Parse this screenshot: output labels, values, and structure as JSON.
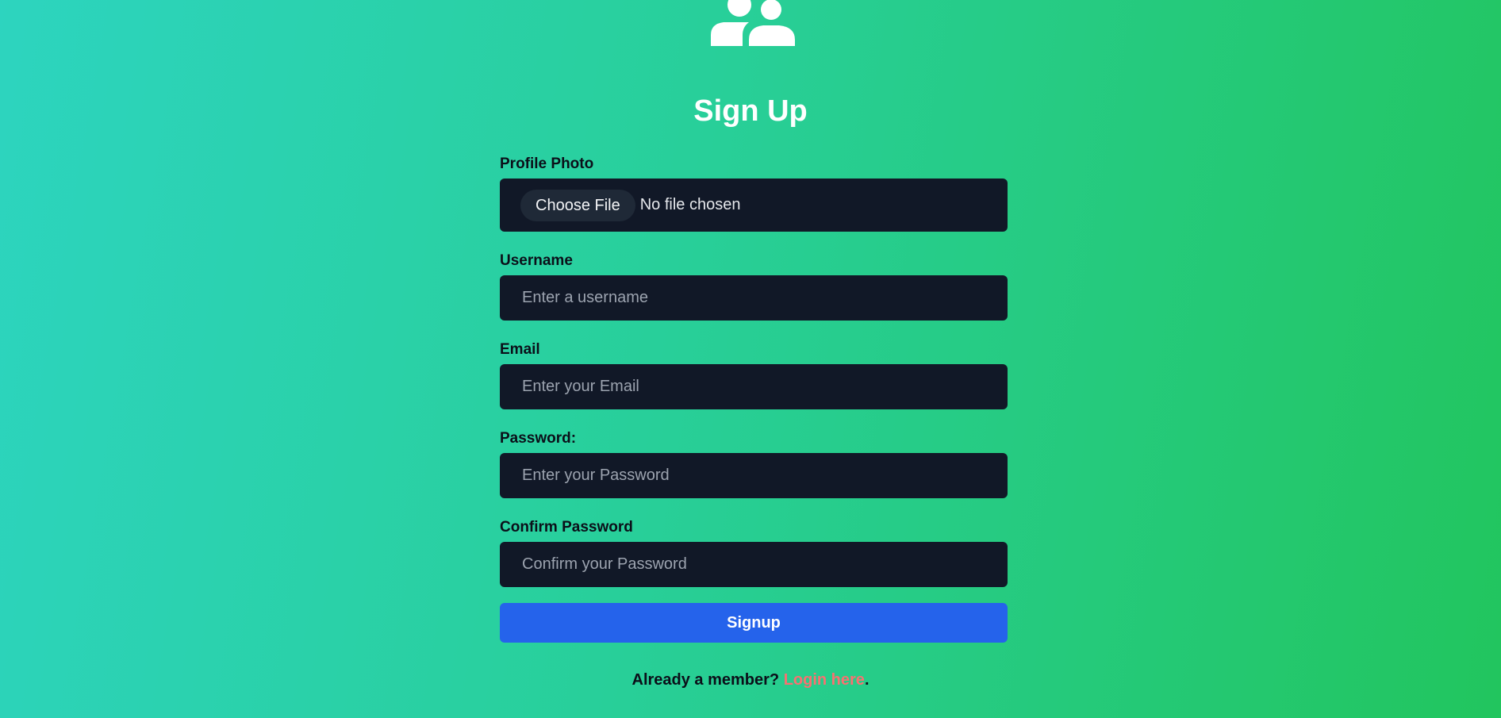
{
  "header": {
    "logo_icon": "users-icon",
    "title": "Sign Up"
  },
  "form": {
    "profile_photo": {
      "label": "Profile Photo",
      "button_label": "Choose File",
      "status": "No file chosen"
    },
    "username": {
      "label": "Username",
      "placeholder": "Enter a username"
    },
    "email": {
      "label": "Email",
      "placeholder": "Enter your Email"
    },
    "password": {
      "label": "Password:",
      "placeholder": "Enter your Password"
    },
    "confirm_password": {
      "label": "Confirm Password",
      "placeholder": "Confirm your Password"
    },
    "submit_label": "Signup"
  },
  "footer": {
    "prompt": "Already a member?",
    "link_label": "Login here",
    "suffix": "."
  },
  "colors": {
    "background_start": "#2dd4bf",
    "background_end": "#22c55e",
    "field_bg": "#111827",
    "button_bg": "#2563eb",
    "link": "#f87171"
  }
}
